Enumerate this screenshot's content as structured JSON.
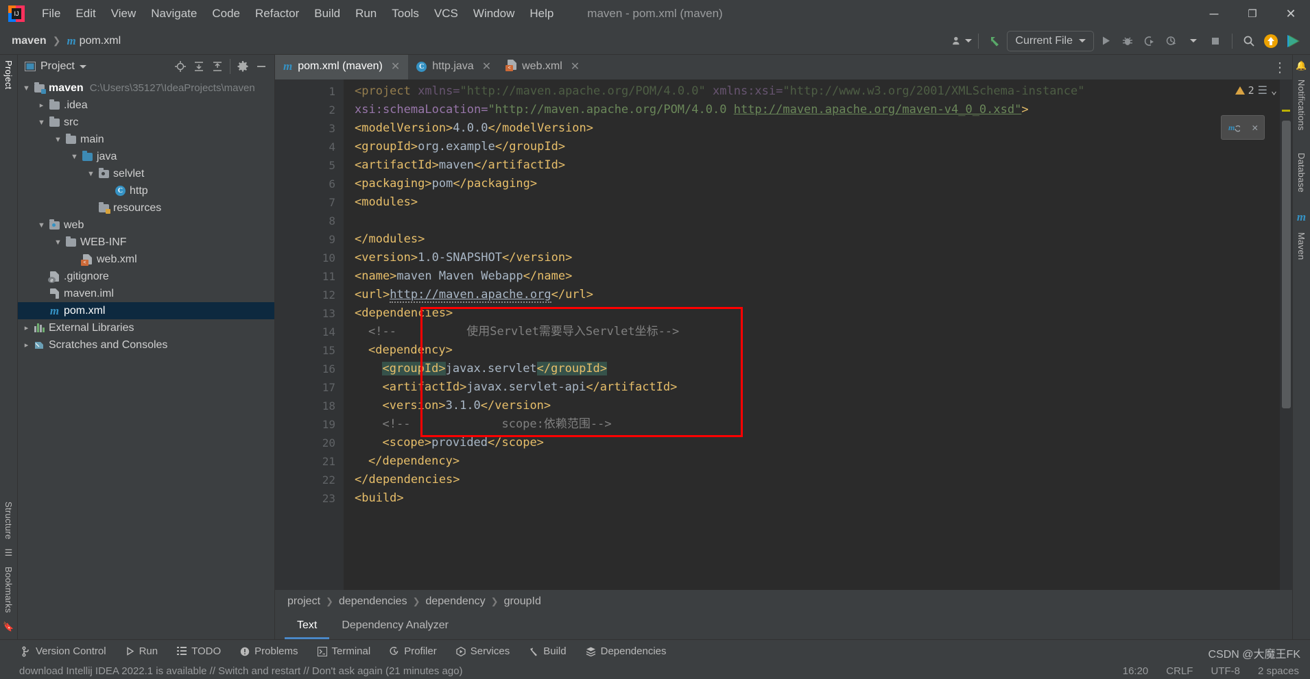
{
  "window": {
    "title": "maven - pom.xml (maven)",
    "minimize_label": "─",
    "maximize_label": "❐",
    "close_label": "✕"
  },
  "menu": {
    "items": [
      {
        "label": "File"
      },
      {
        "label": "Edit"
      },
      {
        "label": "View"
      },
      {
        "label": "Navigate"
      },
      {
        "label": "Code"
      },
      {
        "label": "Refactor"
      },
      {
        "label": "Build"
      },
      {
        "label": "Run"
      },
      {
        "label": "Tools"
      },
      {
        "label": "VCS"
      },
      {
        "label": "Window"
      },
      {
        "label": "Help"
      }
    ]
  },
  "navbar": {
    "crumbs": [
      {
        "label": "maven",
        "icon": ""
      },
      {
        "label": "pom.xml",
        "icon": "maven-m-icon"
      }
    ],
    "run_config": "Current File",
    "icons": [
      "account-icon",
      "updates-arrow-icon",
      "run-icon",
      "debug-icon",
      "run-with-coverage-icon",
      "profiler-icon",
      "stop-icon",
      "search-icon",
      "update-project-icon",
      "ide-services-icon"
    ]
  },
  "left_rail": {
    "top": [
      "Project"
    ],
    "bottom": [
      "Structure",
      "Bookmarks"
    ]
  },
  "right_rail": {
    "items": [
      "Notifications",
      "Database",
      "Maven"
    ]
  },
  "project_panel": {
    "title": "Project",
    "action_icons": [
      "select-opened-file-icon",
      "expand-all-icon",
      "collapse-all-icon",
      "settings-gear-icon",
      "hide-icon"
    ],
    "tree": [
      {
        "label": "maven",
        "path": "C:\\Users\\35127\\IdeaProjects\\maven",
        "indent": 0,
        "arrow": "down",
        "icon": "module-folder-icon",
        "bold": true,
        "selected": false
      },
      {
        "label": ".idea",
        "path": "",
        "indent": 1,
        "arrow": "right",
        "icon": "folder-icon",
        "bold": false,
        "selected": false
      },
      {
        "label": "src",
        "path": "",
        "indent": 1,
        "arrow": "down",
        "icon": "folder-icon",
        "bold": false,
        "selected": false
      },
      {
        "label": "main",
        "path": "",
        "indent": 2,
        "arrow": "down",
        "icon": "folder-icon",
        "bold": false,
        "selected": false
      },
      {
        "label": "java",
        "path": "",
        "indent": 3,
        "arrow": "down",
        "icon": "source-folder-icon",
        "bold": false,
        "selected": false
      },
      {
        "label": "selvlet",
        "path": "",
        "indent": 4,
        "arrow": "down",
        "icon": "package-folder-icon",
        "bold": false,
        "selected": false
      },
      {
        "label": "http",
        "path": "",
        "indent": 5,
        "arrow": "none",
        "icon": "java-class-icon",
        "bold": false,
        "selected": false
      },
      {
        "label": "resources",
        "path": "",
        "indent": 4,
        "arrow": "none",
        "icon": "resources-folder-icon",
        "bold": false,
        "selected": false
      },
      {
        "label": "web",
        "path": "",
        "indent": 1,
        "arrow": "down",
        "icon": "web-folder-icon",
        "bold": false,
        "selected": false
      },
      {
        "label": "WEB-INF",
        "path": "",
        "indent": 2,
        "arrow": "down",
        "icon": "folder-icon",
        "bold": false,
        "selected": false
      },
      {
        "label": "web.xml",
        "path": "",
        "indent": 3,
        "arrow": "none",
        "icon": "web-xml-icon",
        "bold": false,
        "selected": false
      },
      {
        "label": ".gitignore",
        "path": "",
        "indent": 1,
        "arrow": "none",
        "icon": "gitignore-file-icon",
        "bold": false,
        "selected": false
      },
      {
        "label": "maven.iml",
        "path": "",
        "indent": 1,
        "arrow": "none",
        "icon": "iml-file-icon",
        "bold": false,
        "selected": false
      },
      {
        "label": "pom.xml",
        "path": "",
        "indent": 1,
        "arrow": "none",
        "icon": "maven-m-icon",
        "bold": false,
        "selected": true
      },
      {
        "label": "External Libraries",
        "path": "",
        "indent": 0,
        "arrow": "right",
        "icon": "libraries-icon",
        "bold": false,
        "selected": false
      },
      {
        "label": "Scratches and Consoles",
        "path": "",
        "indent": 0,
        "arrow": "right",
        "icon": "scratches-icon",
        "bold": false,
        "selected": false
      }
    ]
  },
  "editor": {
    "tabs": [
      {
        "label": "pom.xml (maven)",
        "icon": "maven-m-icon",
        "active": true,
        "close": "✕"
      },
      {
        "label": "http.java",
        "icon": "java-class-icon",
        "active": false,
        "close": "✕"
      },
      {
        "label": "web.xml",
        "icon": "web-xml-icon",
        "active": false,
        "close": "✕"
      }
    ],
    "more_icon": "⋮",
    "inspection": {
      "warning_count": "2",
      "warning_icon": "warning-triangle-icon",
      "chevron": "⌄"
    },
    "breadcrumbs": [
      "project",
      "dependencies",
      "dependency",
      "groupId"
    ],
    "bottom_tabs": [
      {
        "label": "Text",
        "active": true
      },
      {
        "label": "Dependency Analyzer",
        "active": false
      }
    ],
    "lines": [
      {
        "num": "1",
        "fold": "down",
        "bulb": false
      },
      {
        "num": "2",
        "fold": "",
        "bulb": false
      },
      {
        "num": "3",
        "fold": "",
        "bulb": false
      },
      {
        "num": "4",
        "fold": "",
        "bulb": false
      },
      {
        "num": "5",
        "fold": "",
        "bulb": false
      },
      {
        "num": "6",
        "fold": "",
        "bulb": false
      },
      {
        "num": "7",
        "fold": "down",
        "bulb": false
      },
      {
        "num": "8",
        "fold": "",
        "bulb": false
      },
      {
        "num": "9",
        "fold": "up",
        "bulb": false
      },
      {
        "num": "10",
        "fold": "",
        "bulb": false
      },
      {
        "num": "11",
        "fold": "",
        "bulb": false
      },
      {
        "num": "12",
        "fold": "",
        "bulb": false
      },
      {
        "num": "13",
        "fold": "down",
        "bulb": false
      },
      {
        "num": "14",
        "fold": "",
        "bulb": false
      },
      {
        "num": "15",
        "fold": "down",
        "bulb": false
      },
      {
        "num": "16",
        "fold": "",
        "bulb": true
      },
      {
        "num": "17",
        "fold": "",
        "bulb": false
      },
      {
        "num": "18",
        "fold": "",
        "bulb": false
      },
      {
        "num": "19",
        "fold": "",
        "bulb": false
      },
      {
        "num": "20",
        "fold": "",
        "bulb": false
      },
      {
        "num": "21",
        "fold": "up",
        "bulb": false
      },
      {
        "num": "22",
        "fold": "up",
        "bulb": false
      },
      {
        "num": "23",
        "fold": "down",
        "bulb": false
      }
    ],
    "code_text": {
      "l1": "<project xmlns=\"http://maven.apache.org/POM/4.0.0\" xmlns:xsi=\"http://www.w3.org/2001/XMLSchema-instance\"",
      "l2_attr": "xsi:schemaLocation=",
      "l2_str1": "\"http://maven.apache.org/POM/4.0.0 ",
      "l2_str2": "http://maven.apache.org/maven-v4_0_0.xsd\"",
      "l2_end": ">",
      "l3": "<modelVersion>4.0.0</modelVersion>",
      "l4": "<groupId>org.example</groupId>",
      "l5": "<artifactId>maven</artifactId>",
      "l6": "<packaging>pom</packaging>",
      "l7": "<modules>",
      "l8": "",
      "l9": "</modules>",
      "l10": "<version>1.0-SNAPSHOT</version>",
      "l11": "<name>maven Maven Webapp</name>",
      "l12_url": "http://maven.apache.org",
      "l13": "<dependencies>",
      "l14": "<!--          使用Servlet需要导入Servlet坐标-->",
      "l15": "<dependency>",
      "l16_open": "<groupId>",
      "l16_val": "javax.servlet",
      "l16_close": "</groupId>",
      "l17": "<artifactId>javax.servlet-api</artifactId>",
      "l18": "<version>3.1.0</version>",
      "l19": "<!--             scope:依赖范围-->",
      "l20": "<scope>provided</scope>",
      "l21": "</dependency>",
      "l22": "</dependencies>",
      "l23": "<build>"
    }
  },
  "status_bar": {
    "items": [
      {
        "label": "Version Control",
        "icon": "branch-icon"
      },
      {
        "label": "Run",
        "icon": "run-triangle-icon"
      },
      {
        "label": "TODO",
        "icon": "todo-list-icon"
      },
      {
        "label": "Problems",
        "icon": "problems-icon"
      },
      {
        "label": "Terminal",
        "icon": "terminal-icon"
      },
      {
        "label": "Profiler",
        "icon": "profiler-icon"
      },
      {
        "label": "Services",
        "icon": "services-icon"
      },
      {
        "label": "Build",
        "icon": "build-hammer-icon"
      },
      {
        "label": "Dependencies",
        "icon": "dependencies-icon"
      }
    ],
    "watermark": "CSDN @大魔王FK"
  },
  "bottom_bar": {
    "message": "download Intellij IDEA 2022.1 is available // Switch and restart // Don't ask again (21 minutes ago)",
    "right": [
      "16:20",
      "CRLF",
      "UTF-8",
      "2 spaces"
    ]
  },
  "colors": {
    "accent_blue": "#3592c4",
    "tab_active": "#4e5254",
    "selection_navy": "#0d293f",
    "annotation_red": "#ff0000",
    "highlight_teal": "#36524a",
    "tag_orange": "#e8bf6a",
    "string_green": "#6a8759",
    "attr_purple": "#9876aa",
    "text_grey": "#a9b7c6",
    "comment_grey": "#808080"
  }
}
